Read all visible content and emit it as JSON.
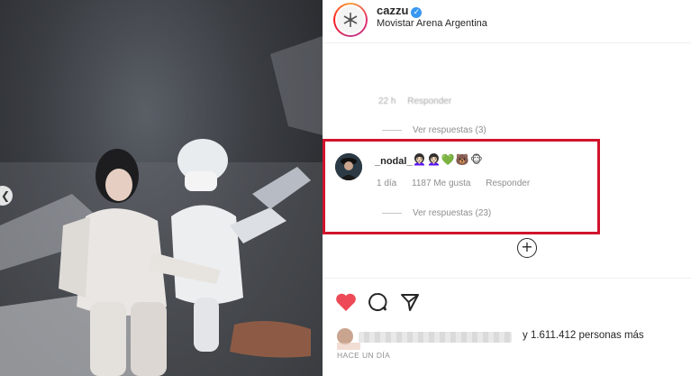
{
  "post": {
    "username": "cazzu",
    "location": "Movistar Arena Argentina"
  },
  "comments": {
    "previous": {
      "time": "22 h",
      "reply_label": "Responder",
      "view_replies": "Ver respuestas (3)"
    },
    "highlighted": {
      "username": "_nodal_",
      "emojis": [
        "👩🏻‍🦱",
        "👩🏻‍🦱",
        "💚",
        "🐻",
        "🐵"
      ],
      "time": "1 día",
      "likes": "1187 Me gusta",
      "reply_label": "Responder",
      "view_replies": "Ver respuestas (23)"
    }
  },
  "likes": {
    "others_text": "y 1.611.412 personas más"
  },
  "timestamp": "HACE UN DÍA",
  "colors": {
    "highlight_border": "#d0142c",
    "like_heart": "#ed4956",
    "verified": "#3897f0"
  },
  "icons": [
    "chevron-left-icon",
    "verified-icon",
    "add-circle-icon",
    "heart-icon",
    "comment-icon",
    "share-icon"
  ]
}
